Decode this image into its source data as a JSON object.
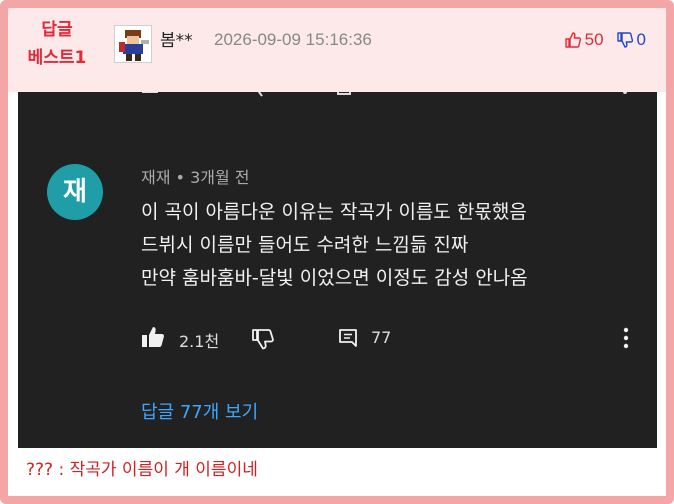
{
  "post": {
    "badge_line1": "답글",
    "badge_line2": "베스트1",
    "username": "봄**",
    "timestamp": "2026-09-09 15:16:36",
    "upvotes": "50",
    "downvotes": "0",
    "caption": "??? : 작곡가 이름이 개 이름이네"
  },
  "youtube_comment": {
    "avatar_letter": "재",
    "author": "재재",
    "separator": "•",
    "time_ago": "3개월 전",
    "lines": [
      "이 곡이 아름다운 이유는 작곡가 이름도 한몫했음",
      "드뷔시 이름만 들어도 수려한 느낌듦 진짜",
      "만약 훔바훔바-달빛 이었으면 이정도 감성 안나옴"
    ],
    "likes": "2.1천",
    "replies": "77",
    "view_replies": "답글 77개 보기"
  },
  "colors": {
    "frame_border": "#f4a6a6",
    "header_bg": "#fde9e9",
    "badge_red": "#e02a3a",
    "downvote_blue": "#1f47c9",
    "yt_bg": "#212121",
    "yt_avatar": "#1f9ea8",
    "yt_link": "#3ea6ff"
  }
}
